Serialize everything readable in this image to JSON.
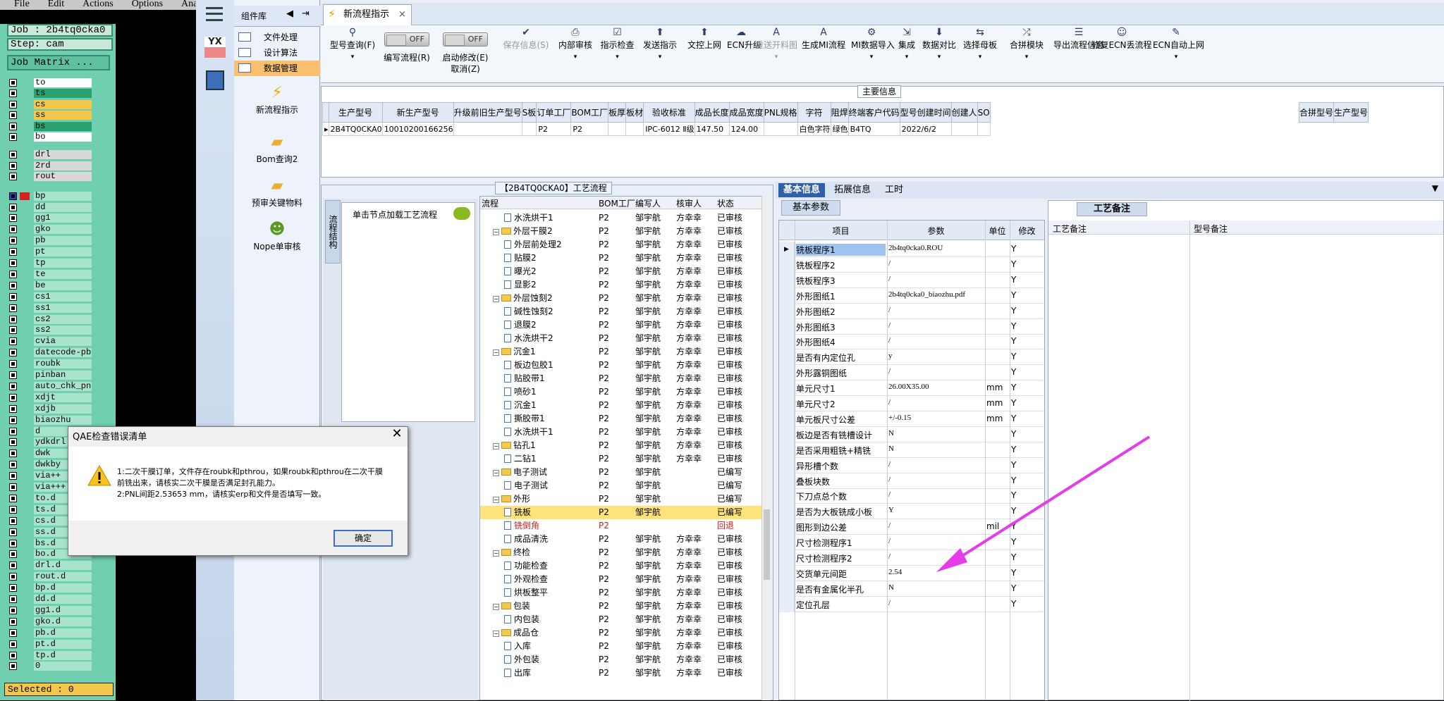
{
  "cam": {
    "menu": [
      "File",
      "Edit",
      "Actions",
      "Options",
      "Analys"
    ],
    "job": "Job : 2b4tq0cka0",
    "step": "Step: cam",
    "job_matrix": "Job Matrix ...",
    "layers": [
      "to",
      "ts",
      "cs",
      "ss",
      "bs",
      "bo",
      "drl",
      "2rd",
      "rout",
      "bp",
      "dd",
      "gg1",
      "gko",
      "pb",
      "pt",
      "tp",
      "te",
      "be",
      "cs1",
      "ss1",
      "cs2",
      "ss2",
      "cvia",
      "datecode-pbe",
      "roubk",
      "pinban",
      "auto_chk_pn",
      "xdjt",
      "xdjb",
      "biaozhu",
      "d",
      "ydkdrl",
      "dwk",
      "dwkby",
      "via++",
      "via+++",
      "to.d",
      "ts.d",
      "cs.d",
      "ss.d",
      "bs.d",
      "bo.d",
      "drl.d",
      "rout.d",
      "bp.d",
      "dd.d",
      "gg1.d",
      "gko.d",
      "pb.d",
      "pt.d",
      "tp.d",
      "0"
    ],
    "selected": "Selected : 0",
    "colors": {
      "highlight": "#f3c74a",
      "active": "#2aa070",
      "default": "#a8e4cc",
      "white": "#ffffff",
      "accent": "#d42020"
    }
  },
  "lib": {
    "title": "组件库",
    "items": [
      "文件处理",
      "设计算法",
      "数据管理"
    ],
    "launchers": [
      "新流程指示",
      "Bom查询2",
      "预审关键物料",
      "Nope单审核"
    ]
  },
  "tab": {
    "title": "新流程指示",
    "close": "×"
  },
  "ribbon": {
    "buttons": [
      {
        "label": "型号查询(F)",
        "icon": "search-icon"
      },
      {
        "label": "编写流程(R)",
        "icon": "toggle",
        "toggle": "OFF"
      },
      {
        "label": "启动修改(E)",
        "label2": "取消(Z)",
        "icon": "toggle",
        "toggle": "OFF"
      },
      {
        "label": "保存信息(S)",
        "icon": "check-icon",
        "disabled": true
      },
      {
        "label": "内部审核",
        "icon": "print-icon"
      },
      {
        "label": "指示检查",
        "icon": "checklist-icon"
      },
      {
        "label": "发送指示",
        "icon": "upload-icon"
      },
      {
        "label": "文控上网",
        "icon": "upload-icon"
      },
      {
        "label": "ECN升级",
        "icon": "cloud-icon"
      },
      {
        "label": "重送开料图",
        "icon": "a-icon",
        "disabled": true
      },
      {
        "label": "生成MI流程",
        "icon": "a-icon"
      },
      {
        "label": "MI数据导入",
        "icon": "gears-icon"
      },
      {
        "label": "集成",
        "icon": "import-icon"
      },
      {
        "label": "数据对比",
        "icon": "download-icon"
      },
      {
        "label": "选择母板",
        "icon": "compare-icon"
      },
      {
        "label": "合拼模块",
        "icon": "shuffle-icon"
      },
      {
        "label": "导出流程信息",
        "icon": "list-icon"
      },
      {
        "label": "修复ECN丢流程",
        "icon": "smile-icon"
      },
      {
        "label": "ECN自动上网",
        "icon": "wrench-icon"
      }
    ]
  },
  "main_info": {
    "title": "主要信息",
    "columns": [
      "生产型号",
      "新生产型号",
      "升级前旧生产型号",
      "S板",
      "订单工厂",
      "BOM工厂",
      "板厚",
      "板材",
      "验收标准",
      "成品长度",
      "成品宽度",
      "PNL规格",
      "字符",
      "阻焊",
      "终端客户代码",
      "型号创建时间",
      "创建人",
      "SO"
    ],
    "row": [
      "2B4TQ0CKA0",
      "10010200166256",
      "",
      "",
      "P2",
      "P2",
      "",
      "",
      "IPC-6012 Ⅱ级",
      "147.50",
      "124.00",
      "",
      "白色字符",
      "绿色",
      "B4TQ",
      "2022/6/2",
      "",
      ""
    ],
    "side_columns": [
      "合拼型号",
      "生产型号"
    ]
  },
  "process": {
    "title": "【2B4TQ0CKA0】工艺流程",
    "vertical_tab": "流程结构",
    "node_hint": "单击节点加载工艺流程",
    "columns": [
      "流程",
      "BOM工厂",
      "编写人",
      "核审人",
      "状态"
    ],
    "rows": [
      {
        "level": 2,
        "type": "file",
        "name": "水洗烘干1",
        "bom": "P2",
        "writer": "邹宇航",
        "reviewer": "方幸幸",
        "status": "已审核"
      },
      {
        "level": 1,
        "type": "folder",
        "name": "外层干膜2",
        "bom": "P2",
        "writer": "邹宇航",
        "reviewer": "方幸幸",
        "status": "已审核"
      },
      {
        "level": 2,
        "type": "file",
        "name": "外层前处理2",
        "bom": "P2",
        "writer": "邹宇航",
        "reviewer": "方幸幸",
        "status": "已审核"
      },
      {
        "level": 2,
        "type": "file",
        "name": "贴膜2",
        "bom": "P2",
        "writer": "邹宇航",
        "reviewer": "方幸幸",
        "status": "已审核"
      },
      {
        "level": 2,
        "type": "file",
        "name": "曝光2",
        "bom": "P2",
        "writer": "邹宇航",
        "reviewer": "方幸幸",
        "status": "已审核"
      },
      {
        "level": 2,
        "type": "file",
        "name": "显影2",
        "bom": "P2",
        "writer": "邹宇航",
        "reviewer": "方幸幸",
        "status": "已审核"
      },
      {
        "level": 1,
        "type": "folder",
        "name": "外层蚀刻2",
        "bom": "P2",
        "writer": "邹宇航",
        "reviewer": "方幸幸",
        "status": "已审核"
      },
      {
        "level": 2,
        "type": "file",
        "name": "碱性蚀刻2",
        "bom": "P2",
        "writer": "邹宇航",
        "reviewer": "方幸幸",
        "status": "已审核"
      },
      {
        "level": 2,
        "type": "file",
        "name": "退膜2",
        "bom": "P2",
        "writer": "邹宇航",
        "reviewer": "方幸幸",
        "status": "已审核"
      },
      {
        "level": 2,
        "type": "file",
        "name": "水洗烘干2",
        "bom": "P2",
        "writer": "邹宇航",
        "reviewer": "方幸幸",
        "status": "已审核"
      },
      {
        "level": 1,
        "type": "folder",
        "name": "沉金1",
        "bom": "P2",
        "writer": "邹宇航",
        "reviewer": "方幸幸",
        "status": "已审核"
      },
      {
        "level": 2,
        "type": "file",
        "name": "板边包胶1",
        "bom": "P2",
        "writer": "邹宇航",
        "reviewer": "方幸幸",
        "status": "已审核"
      },
      {
        "level": 2,
        "type": "file",
        "name": "贴胶带1",
        "bom": "P2",
        "writer": "邹宇航",
        "reviewer": "方幸幸",
        "status": "已审核"
      },
      {
        "level": 2,
        "type": "file",
        "name": "喷砂1",
        "bom": "P2",
        "writer": "邹宇航",
        "reviewer": "方幸幸",
        "status": "已审核"
      },
      {
        "level": 2,
        "type": "file",
        "name": "沉金1",
        "bom": "P2",
        "writer": "邹宇航",
        "reviewer": "方幸幸",
        "status": "已审核"
      },
      {
        "level": 2,
        "type": "file",
        "name": "撕胶带1",
        "bom": "P2",
        "writer": "邹宇航",
        "reviewer": "方幸幸",
        "status": "已审核"
      },
      {
        "level": 2,
        "type": "file",
        "name": "水洗烘干1",
        "bom": "P2",
        "writer": "邹宇航",
        "reviewer": "方幸幸",
        "status": "已审核"
      },
      {
        "level": 1,
        "type": "folder",
        "name": "钻孔1",
        "bom": "P2",
        "writer": "邹宇航",
        "reviewer": "方幸幸",
        "status": "已审核"
      },
      {
        "level": 2,
        "type": "file",
        "name": "二钻1",
        "bom": "P2",
        "writer": "邹宇航",
        "reviewer": "方幸幸",
        "status": "已审核"
      },
      {
        "level": 1,
        "type": "folder",
        "name": "电子测试",
        "bom": "P2",
        "writer": "邹宇航",
        "reviewer": "",
        "status": "已编写"
      },
      {
        "level": 2,
        "type": "file",
        "name": "电子测试",
        "bom": "P2",
        "writer": "邹宇航",
        "reviewer": "",
        "status": "已编写"
      },
      {
        "level": 1,
        "type": "folder",
        "name": "外形",
        "bom": "P2",
        "writer": "邹宇航",
        "reviewer": "",
        "status": "已编写"
      },
      {
        "level": 2,
        "type": "file",
        "name": "铣板",
        "bom": "P2",
        "writer": "邹宇航",
        "reviewer": "",
        "status": "已编写",
        "highlight": true
      },
      {
        "level": 2,
        "type": "file",
        "name": "铣倒角",
        "bom": "P2",
        "writer": "",
        "reviewer": "",
        "status": "回退",
        "red": true
      },
      {
        "level": 2,
        "type": "file",
        "name": "成品清洗",
        "bom": "P2",
        "writer": "邹宇航",
        "reviewer": "方幸幸",
        "status": "已审核"
      },
      {
        "level": 1,
        "type": "folder",
        "name": "终检",
        "bom": "P2",
        "writer": "邹宇航",
        "reviewer": "方幸幸",
        "status": "已审核"
      },
      {
        "level": 2,
        "type": "file",
        "name": "功能检查",
        "bom": "P2",
        "writer": "邹宇航",
        "reviewer": "方幸幸",
        "status": "已审核"
      },
      {
        "level": 2,
        "type": "file",
        "name": "外观检查",
        "bom": "P2",
        "writer": "邹宇航",
        "reviewer": "方幸幸",
        "status": "已审核"
      },
      {
        "level": 2,
        "type": "file",
        "name": "烘板整平",
        "bom": "P2",
        "writer": "邹宇航",
        "reviewer": "方幸幸",
        "status": "已审核"
      },
      {
        "level": 1,
        "type": "folder",
        "name": "包装",
        "bom": "P2",
        "writer": "邹宇航",
        "reviewer": "方幸幸",
        "status": "已审核"
      },
      {
        "level": 2,
        "type": "file",
        "name": "内包装",
        "bom": "P2",
        "writer": "邹宇航",
        "reviewer": "方幸幸",
        "status": "已审核"
      },
      {
        "level": 1,
        "type": "folder",
        "name": "成品仓",
        "bom": "P2",
        "writer": "邹宇航",
        "reviewer": "方幸幸",
        "status": "已审核"
      },
      {
        "level": 2,
        "type": "file",
        "name": "入库",
        "bom": "P2",
        "writer": "邹宇航",
        "reviewer": "方幸幸",
        "status": "已审核"
      },
      {
        "level": 2,
        "type": "file",
        "name": "外包装",
        "bom": "P2",
        "writer": "邹宇航",
        "reviewer": "方幸幸",
        "status": "已审核"
      },
      {
        "level": 2,
        "type": "file",
        "name": "出库",
        "bom": "P2",
        "writer": "邹宇航",
        "reviewer": "方幸幸",
        "status": "已审核"
      }
    ]
  },
  "info_tabs": [
    "基本信息",
    "拓展信息",
    "工时"
  ],
  "basic_params": {
    "title": "基本参数",
    "columns": [
      "项目",
      "参数",
      "单位",
      "修改"
    ],
    "rows": [
      [
        "铣板程序1",
        "2b4tq0cka0.ROU",
        "",
        "Y"
      ],
      [
        "铣板程序2",
        "/",
        "",
        "Y"
      ],
      [
        "铣板程序3",
        "/",
        "",
        "Y"
      ],
      [
        "外形图纸1",
        "2b4tq0cka0_biaozhu.pdf",
        "",
        "Y"
      ],
      [
        "外形图纸2",
        "/",
        "",
        "Y"
      ],
      [
        "外形图纸3",
        "/",
        "",
        "Y"
      ],
      [
        "外形图纸4",
        "/",
        "",
        "Y"
      ],
      [
        "是否有内定位孔",
        "y",
        "",
        "Y"
      ],
      [
        "外形露铜图纸",
        "/",
        "",
        "Y"
      ],
      [
        "单元尺寸1",
        "26.00X35.00",
        "mm",
        "Y"
      ],
      [
        "单元尺寸2",
        "/",
        "mm",
        "Y"
      ],
      [
        "单元板尺寸公差",
        "+/-0.15",
        "mm",
        "Y"
      ],
      [
        "板边是否有铣槽设计",
        "N",
        "",
        "Y"
      ],
      [
        "是否采用粗铣+精铣",
        "N",
        "",
        "Y"
      ],
      [
        "异形槽个数",
        "/",
        "",
        "Y"
      ],
      [
        "叠板块数",
        "/",
        "",
        "Y"
      ],
      [
        "下刀点总个数",
        "/",
        "",
        "Y"
      ],
      [
        "是否为大板铣成小板",
        "Y",
        "",
        "Y"
      ],
      [
        "图形到边公差",
        "/",
        "mil",
        "Y"
      ],
      [
        "尺寸检测程序1",
        "/",
        "",
        "Y"
      ],
      [
        "尺寸检测程序2",
        "/",
        "",
        "Y"
      ],
      [
        "交货单元间距",
        "2.54",
        "",
        "Y"
      ],
      [
        "是否有金属化半孔",
        "N",
        "",
        "Y"
      ],
      [
        "定位孔层",
        "/",
        "",
        "Y"
      ]
    ]
  },
  "remarks": {
    "title": "工艺备注",
    "col1": "工艺备注",
    "col2": "型号备注"
  },
  "dialog": {
    "title": "QAE检查错误清单",
    "close": "✕",
    "lines": [
      "1:二次干膜订单，文件存在roubk和pthrou，如果roubk和pthrou在二次干膜",
      "前铣出来，请核实二次干膜是否满足封孔能力。",
      "2:PNL间距2.53653 mm，请核实erp和文件是否填写一致。"
    ],
    "ok": "确定"
  },
  "arrow_color": "#e43ce6"
}
